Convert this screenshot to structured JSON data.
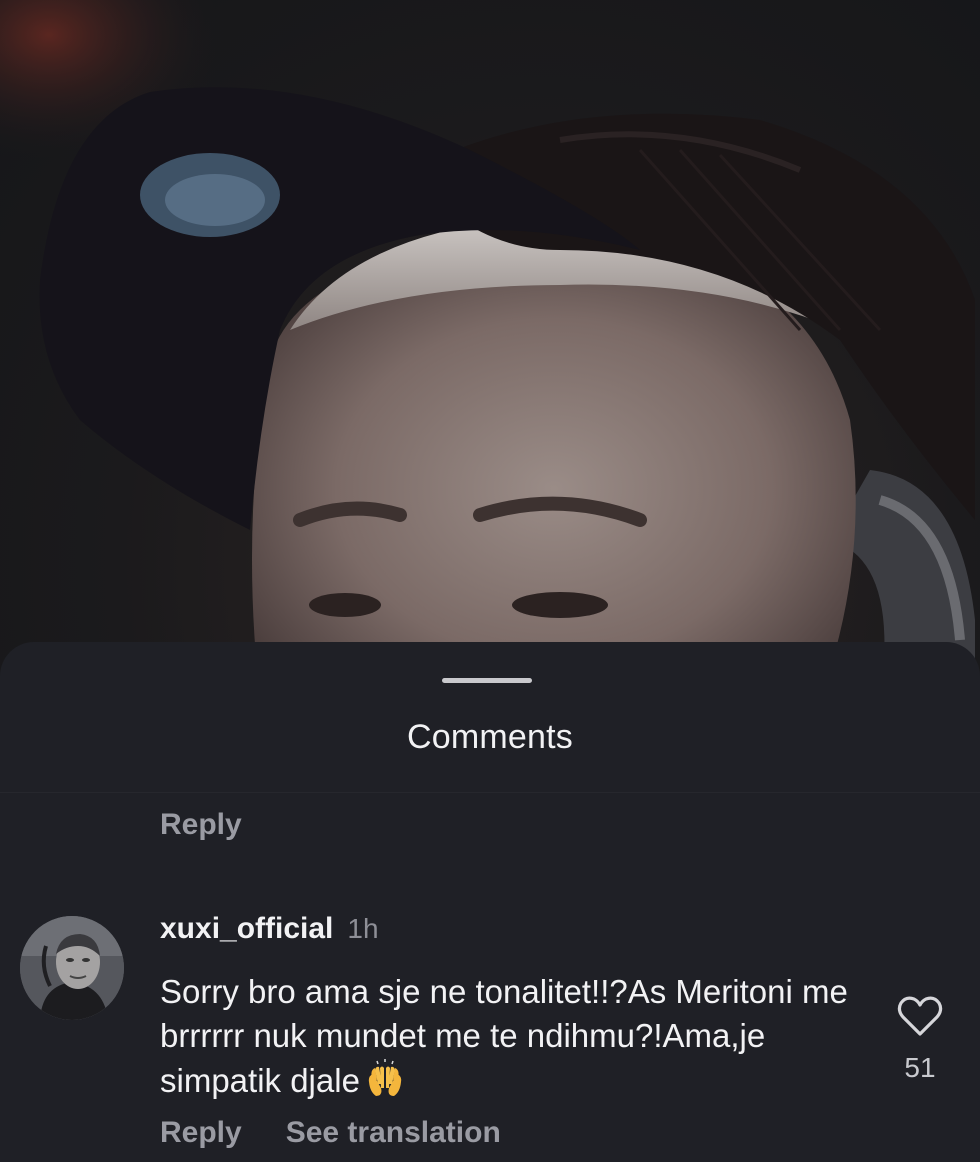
{
  "sheet": {
    "title": "Comments"
  },
  "previous_comment": {
    "reply_label": "Reply"
  },
  "comment": {
    "username": "xuxi_official",
    "timestamp": "1h",
    "text": "Sorry bro ama sje ne tonalitet!!?As Meritoni me brrrrrr nuk mundet me te ndihmu?!Ama,je simpatik djale",
    "emoji": "raising-hands",
    "like_count": "51",
    "reply_label": "Reply",
    "translate_label": "See translation"
  },
  "icons": {
    "like": "heart-outline-icon",
    "emoji": "raising-hands-emoji"
  },
  "colors": {
    "sheet_background": "#1f2026",
    "primary_text": "#f2f2f4",
    "secondary_text": "#9a9ba3",
    "emoji_yellow": "#f4b63c"
  }
}
